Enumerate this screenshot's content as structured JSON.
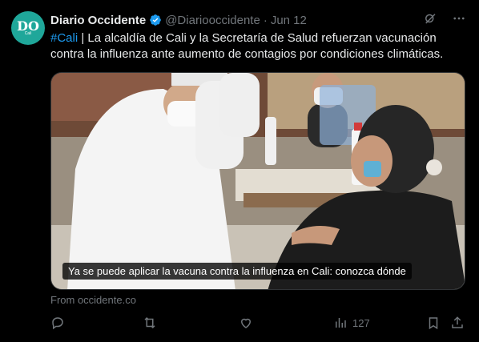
{
  "post": {
    "avatar": {
      "logo": "DO",
      "sub": "Cali"
    },
    "author_name": "Diario Occidente",
    "handle": "@Diariooccidente",
    "separator": "·",
    "date": "Jun 12",
    "hashtag": "#Cali",
    "body": " | La alcaldía de Cali y la Secretaría de Salud refuerzan vacunación contra la influenza ante aumento de contagios por condiciones climáticas.",
    "media_caption": "Ya se puede aplicar la vacuna contra la influenza en Cali: conozca dónde",
    "link_source": "From occidente.co",
    "views": "127"
  },
  "colors": {
    "accent": "#1d9bf0",
    "muted": "#71767b",
    "text": "#e7e9ea",
    "avatar_bg": "#1fa79a"
  },
  "icons": [
    "verified-badge-icon",
    "grok-icon",
    "more-icon",
    "reply-icon",
    "repost-icon",
    "like-icon",
    "views-icon",
    "bookmark-icon",
    "share-icon"
  ]
}
